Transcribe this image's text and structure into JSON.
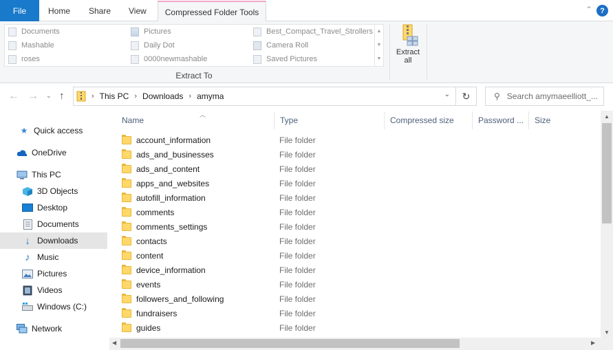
{
  "tabs": {
    "file": "File",
    "home": "Home",
    "share": "Share",
    "view": "View",
    "context": "Compressed Folder Tools",
    "help": "?",
    "collapse": "⌃"
  },
  "ribbon": {
    "gallery": [
      {
        "label": "Documents",
        "icon": "document-icon"
      },
      {
        "label": "Mashable",
        "icon": "document-icon"
      },
      {
        "label": "roses",
        "icon": "document-icon"
      },
      {
        "label": "Pictures",
        "icon": "pictures-icon"
      },
      {
        "label": "Daily Dot",
        "icon": "document-icon"
      },
      {
        "label": "0000newmashable",
        "icon": "document-icon"
      },
      {
        "label": "Best_Compact_Travel_Strollers",
        "icon": "document-icon"
      },
      {
        "label": "Camera Roll",
        "icon": "document-icon"
      },
      {
        "label": "Saved Pictures",
        "icon": "document-icon"
      }
    ],
    "group_label": "Extract To",
    "extract_all": "Extract all"
  },
  "address": {
    "crumbs": [
      "This PC",
      "Downloads",
      "amyma"
    ],
    "search_placeholder": "Search amymaeelliott_..."
  },
  "nav": {
    "quick_access": "Quick access",
    "onedrive": "OneDrive",
    "this_pc": "This PC",
    "objects3d": "3D Objects",
    "desktop": "Desktop",
    "documents": "Documents",
    "downloads": "Downloads",
    "music": "Music",
    "pictures": "Pictures",
    "videos": "Videos",
    "windows_c": "Windows (C:)",
    "network": "Network"
  },
  "columns": {
    "name": "Name",
    "type": "Type",
    "compressed_size": "Compressed size",
    "password": "Password ...",
    "size": "Size"
  },
  "files": [
    {
      "name": "account_information",
      "type": "File folder"
    },
    {
      "name": "ads_and_businesses",
      "type": "File folder"
    },
    {
      "name": "ads_and_content",
      "type": "File folder"
    },
    {
      "name": "apps_and_websites",
      "type": "File folder"
    },
    {
      "name": "autofill_information",
      "type": "File folder"
    },
    {
      "name": "comments",
      "type": "File folder"
    },
    {
      "name": "comments_settings",
      "type": "File folder"
    },
    {
      "name": "contacts",
      "type": "File folder"
    },
    {
      "name": "content",
      "type": "File folder"
    },
    {
      "name": "device_information",
      "type": "File folder"
    },
    {
      "name": "events",
      "type": "File folder"
    },
    {
      "name": "followers_and_following",
      "type": "File folder"
    },
    {
      "name": "fundraisers",
      "type": "File folder"
    },
    {
      "name": "guides",
      "type": "File folder"
    }
  ],
  "colors": {
    "file_tab": "#1979ca",
    "context_tab_accent": "#f0a8c7",
    "folder": "#ffd869",
    "selected": "#e5e5e5"
  }
}
